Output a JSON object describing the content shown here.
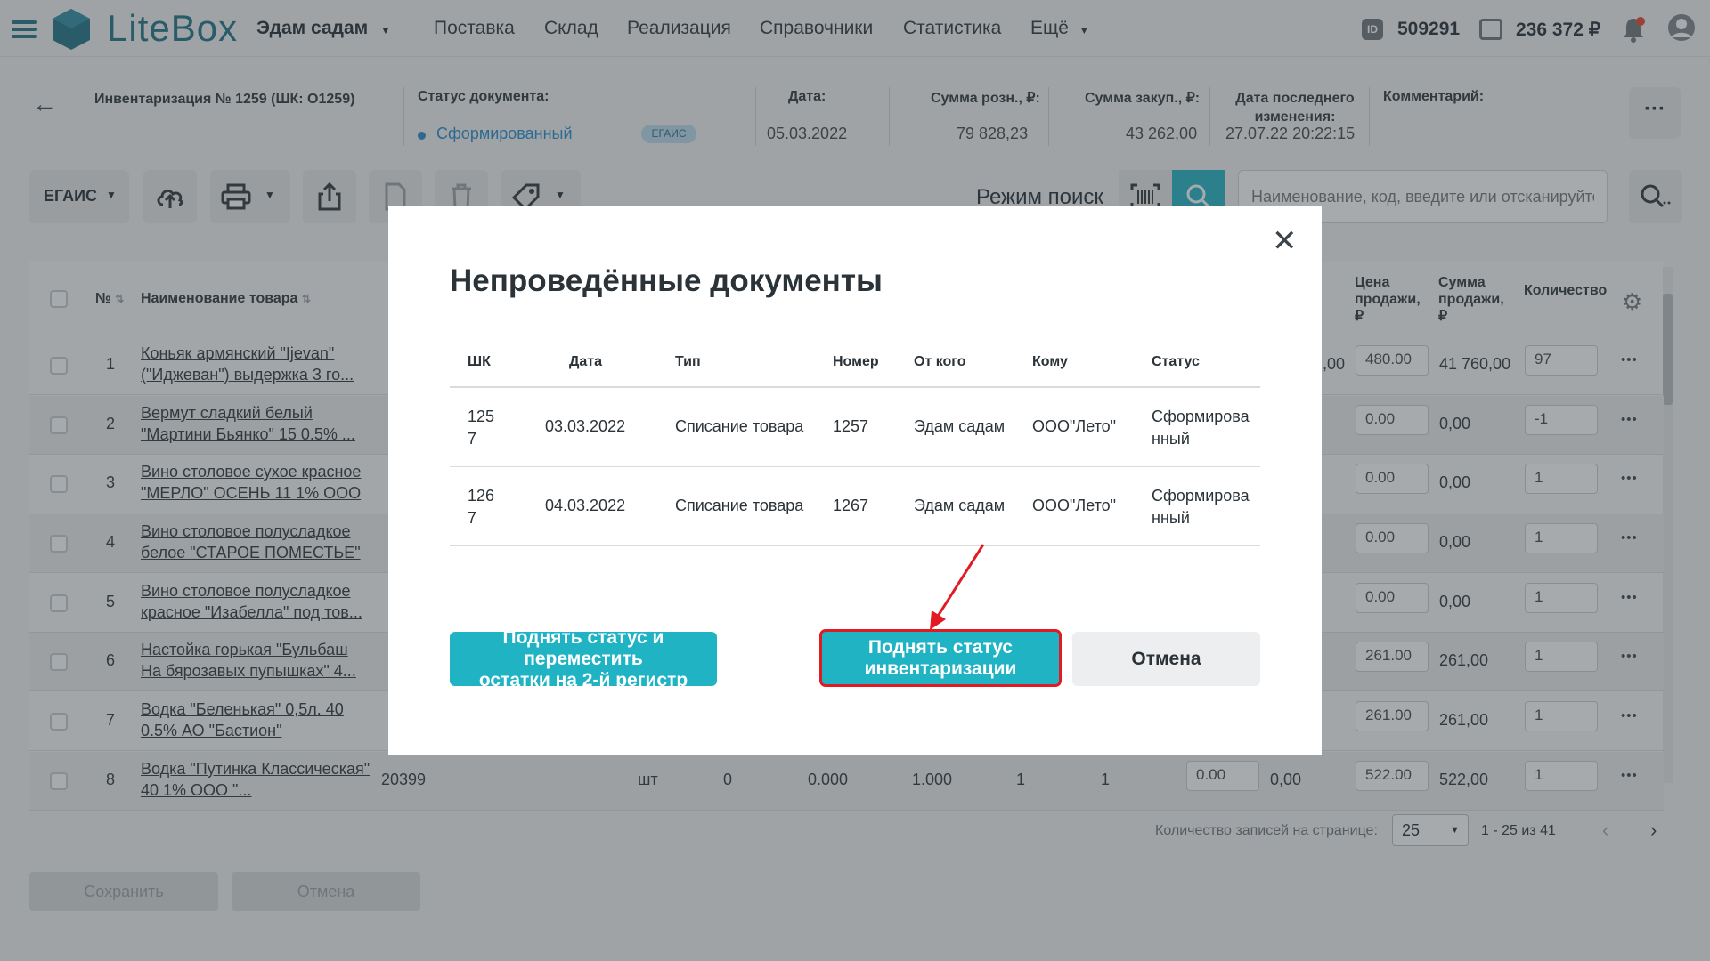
{
  "header": {
    "logo_text": "LiteBox",
    "store": "Эдам садам",
    "nav": [
      "Поставка",
      "Склад",
      "Реализация",
      "Справочники",
      "Статистика",
      "Ещё"
    ],
    "account_id": "509291",
    "balance": "236 372 ₽"
  },
  "doc": {
    "title": "Инвентаризация № 1259 (ШК: O1259)",
    "status_label": "Статус документа:",
    "status_value": "Сформированный",
    "egais_badge": "ЕГАИС",
    "date_label": "Дата:",
    "date_value": "05.03.2022",
    "retail_label": "Сумма розн., ₽:",
    "retail_value": "79 828,23",
    "purchase_label": "Сумма закуп., ₽:",
    "purchase_value": "43 262,00",
    "last_change_label": "Дата последнего изменения:",
    "last_change_value": "27.07.22 20:22:15",
    "comment_label": "Комментарий:"
  },
  "toolbar": {
    "egais_button": "ЕГАИС",
    "search_mode_label": "Режим поиск",
    "search_placeholder": "Наименование, код, введите или отсканируйте"
  },
  "table": {
    "headers": {
      "num": "№",
      "name": "Наименование товара",
      "price": "Цена продажи, ₽",
      "sum": "Сумма продажи, ₽",
      "qty": "Количество"
    },
    "rows": [
      {
        "n": "1",
        "name": "Коньяк армянский \"Ijevan\" (\"Иджеван\") выдержка 3 го...",
        "price": "480.00",
        "sum": "41 760,00",
        "qty": "97"
      },
      {
        "n": "2",
        "name": "Вермут сладкий белый \"Мартини Бьянко\" 15 0.5% ...",
        "price": "0.00",
        "sum": "0,00",
        "qty": "-1"
      },
      {
        "n": "3",
        "name": "Вино столовое сухое красное \"МЕРЛО\" ОСЕНЬ 11 1% ООО ...",
        "price": "0.00",
        "sum": "0,00",
        "qty": "1"
      },
      {
        "n": "4",
        "name": "Вино столовое полусладкое белое \"СТАРОЕ ПОМЕСТЬЕ\" ...",
        "price": "0.00",
        "sum": "0,00",
        "qty": "1"
      },
      {
        "n": "5",
        "name": "Вино столовое полусладкое красное \"Изабелла\" под тов...",
        "price": "0.00",
        "sum": "0,00",
        "qty": "1"
      },
      {
        "n": "6",
        "name": "Настойка горькая \"Бульбаш На бярозавых пупышках\" 4...",
        "price": "261.00",
        "sum": "261,00",
        "qty": "1"
      },
      {
        "n": "7",
        "name": "Водка \"Беленькая\" 0,5л. 40 0.5% АО \"Бастион\"",
        "price": "261.00",
        "sum": "261,00",
        "qty": "1"
      },
      {
        "n": "8",
        "name": "Водка \"Путинка Классическая\" 40 1% ООО \"...",
        "price": "522.00",
        "sum": "522,00",
        "qty": "1"
      }
    ],
    "row8_extra": {
      "code": "20399",
      "unit": "шт",
      "c1": "0",
      "c2": "0.000",
      "c3": "1.000",
      "c4": "1",
      "c5": "1",
      "c6": "0.00",
      "c7": "0,00"
    },
    "row1_partial": ",00"
  },
  "pagination": {
    "per_page_label": "Количество записей на странице:",
    "per_page": "25",
    "range": "1 - 25 из 41"
  },
  "footer": {
    "save": "Сохранить",
    "cancel": "Отмена"
  },
  "modal": {
    "title": "Непроведённые документы",
    "columns": [
      "ШК",
      "Дата",
      "Тип",
      "Номер",
      "От кого",
      "Кому",
      "Статус"
    ],
    "rows": [
      {
        "code_line1": "125",
        "code_line2": "7",
        "date": "03.03.2022",
        "type": "Списание товара",
        "number": "1257",
        "from": "Эдам садам",
        "to": "ООО\"Лето\"",
        "status_line1": "Сформирова",
        "status_line2": "нный"
      },
      {
        "code_line1": "126",
        "code_line2": "7",
        "date": "04.03.2022",
        "type": "Списание товара",
        "number": "1267",
        "from": "Эдам садам",
        "to": "ООО\"Лето\"",
        "status_line1": "Сформирова",
        "status_line2": "нный"
      }
    ],
    "btn_move_line1": "Поднять статус и переместить",
    "btn_move_line2": "остатки на 2-й регистр",
    "btn_raise_line1": "Поднять статус",
    "btn_raise_line2": "инвентаризации",
    "btn_cancel": "Отмена"
  },
  "colors": {
    "teal": "#1fb3c3",
    "brand": "#1a6f86",
    "highlight": "#e01b24",
    "status_dot": "#1f8bd0"
  }
}
